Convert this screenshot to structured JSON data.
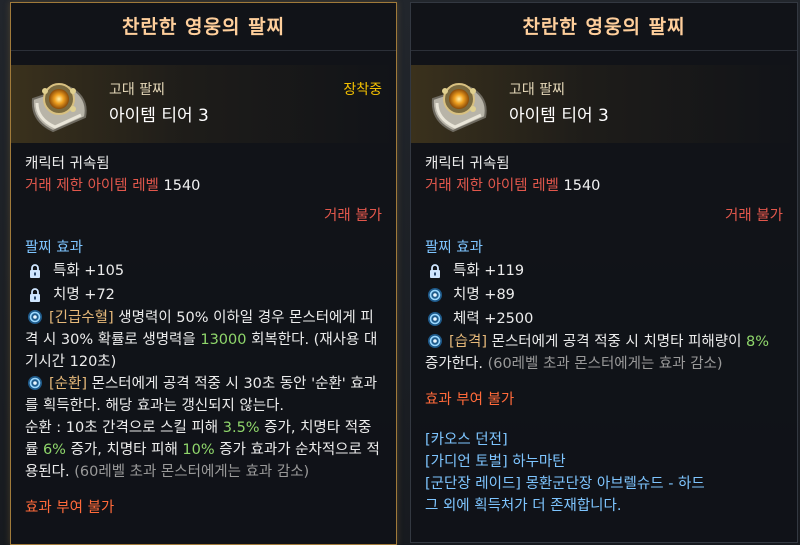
{
  "left": {
    "title": "찬란한 영웅의 팔찌",
    "grade": "고대 팔찌",
    "tier": "아이템 티어 3",
    "equipped": "장착중",
    "bound": "캐릭터 귀속됨",
    "trade_limit_label": "거래 제한 아이템 레벨",
    "trade_limit_value": "1540",
    "untradeable": "거래 불가",
    "effect_title": "팔찌 효과",
    "stats": [
      {
        "icon": "lock-icon",
        "text": "특화 +105"
      },
      {
        "icon": "lock-icon",
        "text": "치명 +72"
      }
    ],
    "effect1": {
      "name": "[긴급수혈]",
      "t1": " 생명력이 50% 이하일 경우 몬스터에게 피격 시 30% 확률로 생명력을 ",
      "v1": "13000",
      "t2": " 회복한다. (재사용 대기시간 120초)"
    },
    "effect2": {
      "name": "[순환]",
      "t1": " 몬스터에게 공격 적중 시 30초 동안 '순환' 효과를 획득한다. 해당 효과는 갱신되지 않는다.",
      "t2": "순환 : 10초 간격으로 스킬 피해 ",
      "v1": "3.5%",
      "t3": " 증가, 치명타 적중률 ",
      "v2": "6%",
      "t4": " 증가, 치명타 피해 ",
      "v3": "10%",
      "t5": " 증가 효과가 순차적으로 적용된다.",
      "note": " (60레벨 초과 몬스터에게는 효과 감소)"
    },
    "no_grant": "효과 부여 불가"
  },
  "right": {
    "title": "찬란한 영웅의 팔찌",
    "grade": "고대 팔찌",
    "tier": "아이템 티어 3",
    "bound": "캐릭터 귀속됨",
    "trade_limit_label": "거래 제한 아이템 레벨",
    "trade_limit_value": "1540",
    "untradeable": "거래 불가",
    "effect_title": "팔찌 효과",
    "stats": [
      {
        "icon": "lock-icon",
        "text": "특화 +119"
      },
      {
        "icon": "swirl-icon",
        "text": "치명 +89"
      },
      {
        "icon": "swirl-icon",
        "text": "체력 +2500"
      }
    ],
    "effect1": {
      "name": "[습격]",
      "t1": " 몬스터에게 공격 적중 시 치명타 피해량이 ",
      "v1": "8%",
      "t2": " 증가한다.",
      "note": " (60레벨 초과 몬스터에게는 효과 감소)"
    },
    "no_grant": "효과 부여 불가",
    "sources": [
      "[카오스 던전]",
      "[가디언 토벌] 하누마탄",
      "[군단장 레이드] 몽환군단장 아브렐슈드 - 하드",
      "그 외에 획득처가 더 존재합니다."
    ]
  },
  "colors": {
    "title": "#ffcf9c",
    "equipped": "#f3c000",
    "red": "#e2574c",
    "section": "#7ec5ff",
    "highlight": "#8fd66b"
  }
}
